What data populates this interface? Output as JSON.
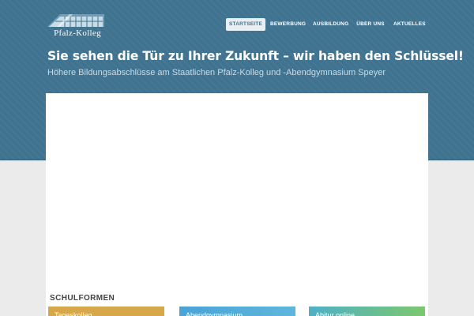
{
  "logo": {
    "text": "Pfalz-Kolleg"
  },
  "nav": {
    "items": [
      {
        "label": "STARTSEITE",
        "active": true
      },
      {
        "label": "BEWERBUNG",
        "active": false
      },
      {
        "label": "AUSBILDUNG",
        "active": false
      },
      {
        "label": "ÜBER UNS",
        "active": false
      },
      {
        "label": "AKTUELLES",
        "active": false
      }
    ]
  },
  "hero": {
    "headline": "Sie sehen die Tür zu Ihrer Zukunft – wir haben den Schlüssel!",
    "subline": "Höhere Bildungsabschlüsse am Staatlichen Pfalz-Kolleg und -Abendgymnasium Speyer"
  },
  "schulformen": {
    "title": "SCHULFORMEN",
    "cards": [
      {
        "label": "Tageskolleg",
        "color": "#d6a84a"
      },
      {
        "label": "Abendgymnasium",
        "color": "#4aa3d6"
      },
      {
        "label": "Abitur online",
        "color": "#6fbf7a"
      }
    ]
  },
  "colors": {
    "hero_bg": "#3f7390",
    "page_bg": "#ebebeb",
    "panel_bg": "#ffffff"
  }
}
